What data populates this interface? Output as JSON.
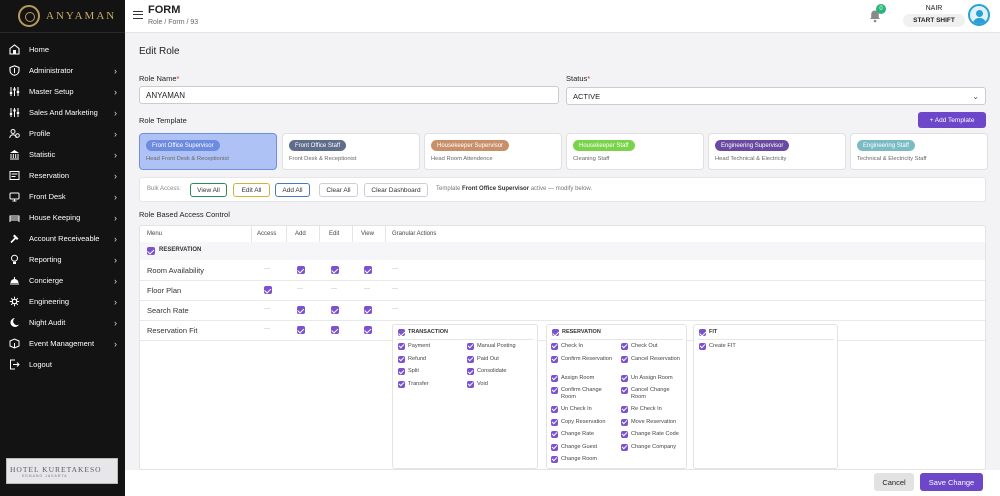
{
  "brand": {
    "name": "ANYAMAN"
  },
  "sidebar": {
    "items": [
      {
        "label": "Home",
        "icon": "home-icon",
        "chevron": false
      },
      {
        "label": "Administrator",
        "icon": "shield-dollar-icon",
        "chevron": true
      },
      {
        "label": "Master Setup",
        "icon": "sliders-icon",
        "chevron": true
      },
      {
        "label": "Sales And Marketing",
        "icon": "sliders-icon",
        "chevron": true
      },
      {
        "label": "Profile",
        "icon": "profile-group-icon",
        "chevron": true
      },
      {
        "label": "Statistic",
        "icon": "bank-icon",
        "chevron": true
      },
      {
        "label": "Reservation",
        "icon": "reservation-icon",
        "chevron": true
      },
      {
        "label": "Front Desk",
        "icon": "front-desk-icon",
        "chevron": true
      },
      {
        "label": "House Keeping",
        "icon": "housekeeping-icon",
        "chevron": true
      },
      {
        "label": "Account Receiveable",
        "icon": "hammer-icon",
        "chevron": true
      },
      {
        "label": "Reporting",
        "icon": "bulb-icon",
        "chevron": true
      },
      {
        "label": "Concierge",
        "icon": "concierge-bell-icon",
        "chevron": true
      },
      {
        "label": "Engineering",
        "icon": "engineering-icon",
        "chevron": true
      },
      {
        "label": "Night Audit",
        "icon": "night-audit-icon",
        "chevron": true
      },
      {
        "label": "Event Management",
        "icon": "event-icon",
        "chevron": true
      },
      {
        "label": "Logout",
        "icon": "logout-icon",
        "chevron": false
      }
    ]
  },
  "hotel_logo": {
    "text": "HOTEL KURETAKESO",
    "subtext": "KEMANG JAKARTA"
  },
  "header": {
    "title": "FORM",
    "breadcrumb": "Role  /  Form  /  93",
    "notification_count": "0",
    "user_name": "NAIR",
    "shift": "START SHIFT"
  },
  "form": {
    "heading": "Edit Role",
    "role_name_label": "Role Name",
    "role_name_value": "ANYAMAN",
    "status_label": "Status",
    "status_value": "ACTIVE",
    "template_label": "Role Template",
    "add_template": "+ Add Template"
  },
  "templates": [
    {
      "name": "Front Office Supervisor",
      "desc": "Head Front Desk & Receptionist",
      "color": "#6d8bdf",
      "active": true
    },
    {
      "name": "Front Office Staff",
      "desc": "Front Desk & Receptionist",
      "color": "#5f6d8a",
      "active": false
    },
    {
      "name": "Housekeeper Supervisor",
      "desc": "Head Room Attendence",
      "color": "#c8906a",
      "active": false
    },
    {
      "name": "Housekeeper Staff",
      "desc": "Cleaning Staff",
      "color": "#7ad44a",
      "active": false
    },
    {
      "name": "Engineering Supervisor",
      "desc": "Head Technical & Electricity",
      "color": "#6a4aa0",
      "active": false
    },
    {
      "name": "Engineering Staff",
      "desc": "Technical & Electricity Staff",
      "color": "#7bbcc4",
      "active": false
    }
  ],
  "bulk": {
    "label": "Bulk Access:",
    "view_all": "View All",
    "edit_all": "Edit All",
    "add_all": "Add All",
    "clear_all": "Clear All",
    "clear_dashboard": "Clear Dashboard",
    "note_prefix": "Template",
    "note_template": "Front Office Supervisor",
    "note_suffix": "active — modify below."
  },
  "rbac": {
    "title": "Role Based Access Control",
    "columns": [
      "Menu",
      "Access",
      "Add",
      "Edit",
      "View",
      "Granular Actions"
    ],
    "section": "RESERVATION",
    "rows": [
      {
        "name": "Room Availability",
        "access": false,
        "add": true,
        "edit": true,
        "view": true
      },
      {
        "name": "Floor Plan",
        "access": true,
        "add": false,
        "edit": false,
        "view": false
      },
      {
        "name": "Search Rate",
        "access": false,
        "add": true,
        "edit": true,
        "view": true
      },
      {
        "name": "Reservation Fit",
        "access": false,
        "add": true,
        "edit": true,
        "view": true
      }
    ],
    "dash": "—"
  },
  "granular": {
    "transaction": {
      "title": "TRANSACTION",
      "col1": [
        "Payment",
        "Refund",
        "Split",
        "Transfer"
      ],
      "col2": [
        "Manual Posting",
        "Paid Out",
        "Consolidate",
        "Void"
      ]
    },
    "reservation": {
      "title": "RESERVATION",
      "col1": [
        "Check In",
        "Confirm Reservation",
        "Assign Room",
        "Confirm Change Room",
        "Un Check In",
        "Copy Reservation",
        "Change Rate",
        "Change Guest",
        "Change Room"
      ],
      "col2": [
        "Check Out",
        "Cancel Reservation",
        "Un Assign Room",
        "Cancel Change Room",
        "Re Check In",
        "Move Reservation",
        "Change Rate Code",
        "Change Company"
      ]
    },
    "fit": {
      "title": "FIT",
      "items": [
        "Create FIT"
      ]
    }
  },
  "footer": {
    "cancel": "Cancel",
    "save": "Save Change"
  },
  "colors": {
    "accent": "#6c47c9",
    "sidebar_bg": "#131313",
    "brand_gold": "#c9ab6a",
    "checkbox": "#7b52d1"
  }
}
